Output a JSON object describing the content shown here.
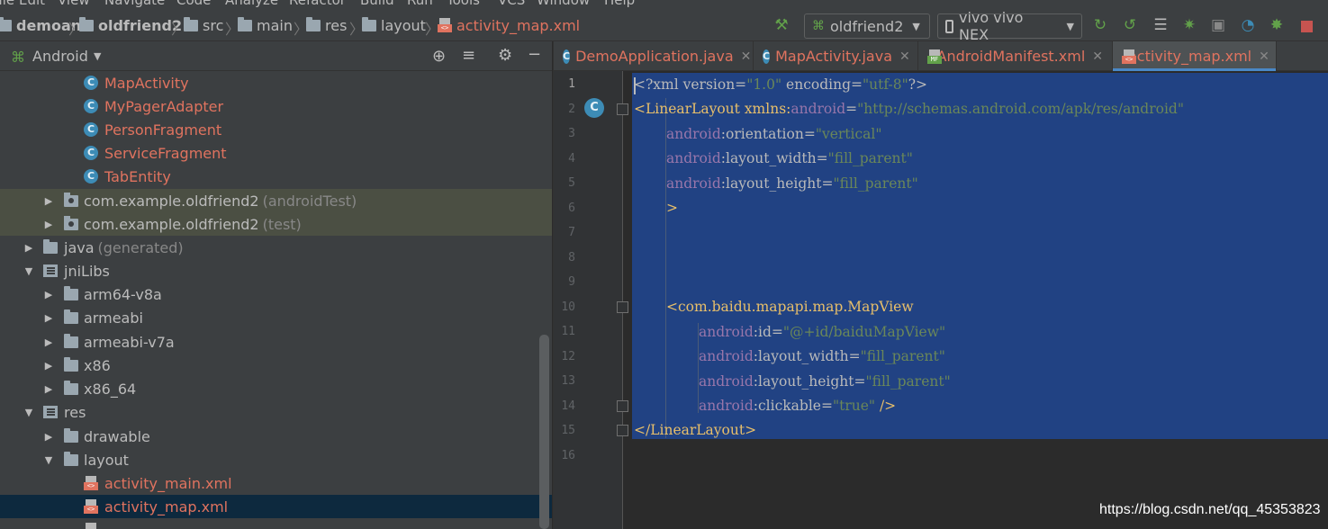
{
  "menu": [
    "File",
    "Edit",
    "View",
    "Navigate",
    "Code",
    "Analyze",
    "Refactor",
    "Build",
    "Run",
    "Tools",
    "VCS",
    "Window",
    "Help"
  ],
  "breadcrumb": [
    "demoan",
    "oldfriend2",
    "src",
    "main",
    "res",
    "layout",
    "activity_map.xml"
  ],
  "toolbar": {
    "run_config": "oldfriend2",
    "device": "vivo vivo NEX"
  },
  "project_panel": {
    "view_mode": "Android",
    "items": [
      {
        "label": "MapActivity",
        "type": "class"
      },
      {
        "label": "MyPagerAdapter",
        "type": "class"
      },
      {
        "label": "PersonFragment",
        "type": "class"
      },
      {
        "label": "ServiceFragment",
        "type": "class"
      },
      {
        "label": "TabEntity",
        "type": "class"
      },
      {
        "label": "com.example.oldfriend2",
        "suffix": "(androidTest)",
        "type": "package"
      },
      {
        "label": "com.example.oldfriend2",
        "suffix": "(test)",
        "type": "package"
      },
      {
        "label": "java",
        "suffix": "(generated)",
        "type": "folder"
      },
      {
        "label": "jniLibs",
        "type": "folder"
      },
      {
        "label": "arm64-v8a",
        "type": "folder"
      },
      {
        "label": "armeabi",
        "type": "folder"
      },
      {
        "label": "armeabi-v7a",
        "type": "folder"
      },
      {
        "label": "x86",
        "type": "folder"
      },
      {
        "label": "x86_64",
        "type": "folder"
      },
      {
        "label": "res",
        "type": "folder"
      },
      {
        "label": "drawable",
        "type": "folder"
      },
      {
        "label": "layout",
        "type": "folder"
      },
      {
        "label": "activity_main.xml",
        "type": "xml"
      },
      {
        "label": "activity_map.xml",
        "type": "xml"
      }
    ]
  },
  "tabs": [
    {
      "label": "DemoApplication.java"
    },
    {
      "label": "MapActivity.java"
    },
    {
      "label": "AndroidManifest.xml"
    },
    {
      "label": "activity_map.xml",
      "active": true
    }
  ],
  "code": {
    "line_numbers": [
      "1",
      "2",
      "3",
      "4",
      "5",
      "6",
      "7",
      "8",
      "9",
      "10",
      "11",
      "12",
      "13",
      "14",
      "15",
      "16"
    ],
    "l1": {
      "a": "<?xml version=",
      "b": "\"1.0\"",
      "c": " encoding=",
      "d": "\"utf-8\"",
      "e": "?>"
    },
    "l2": {
      "a": "<LinearLayout ",
      "b": "xmlns:",
      "c": "android",
      "d": "=",
      "e": "\"http://schemas.android.com/apk/res/android\""
    },
    "l3": {
      "ns": "android",
      "attr": ":orientation",
      "eq": "=",
      "val": "\"vertical\""
    },
    "l4": {
      "ns": "android",
      "attr": ":layout_width",
      "eq": "=",
      "val": "\"fill_parent\""
    },
    "l5": {
      "ns": "android",
      "attr": ":layout_height",
      "eq": "=",
      "val": "\"fill_parent\""
    },
    "l6": ">",
    "l10": "<com.baidu.mapapi.map.MapView",
    "l11": {
      "ns": "android",
      "attr": ":id",
      "eq": "=",
      "val": "\"@+id/baiduMapView\""
    },
    "l12": {
      "ns": "android",
      "attr": ":layout_width",
      "eq": "=",
      "val": "\"fill_parent\""
    },
    "l13": {
      "ns": "android",
      "attr": ":layout_height",
      "eq": "=",
      "val": "\"fill_parent\""
    },
    "l14": {
      "ns": "android",
      "attr": ":clickable",
      "eq": "=",
      "val": "\"true\"",
      "end": " />"
    },
    "l15": "</LinearLayout>"
  },
  "watermark": "https://blog.csdn.net/qq_45353823",
  "colors": {
    "accent": "#4a88c7",
    "selection": "#214283",
    "file_modified": "#e0735f"
  }
}
